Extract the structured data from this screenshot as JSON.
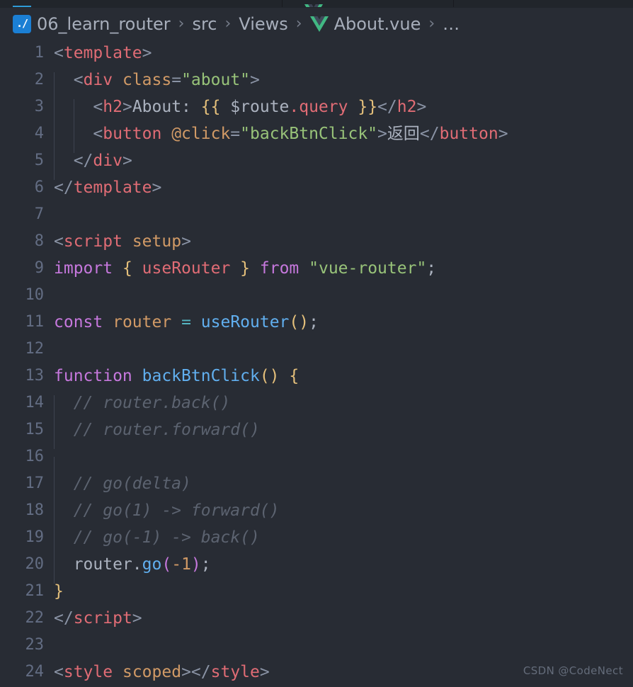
{
  "window": {
    "background": "#282c34",
    "tabbar_background": "#21252b",
    "accent": "#2f9bd8"
  },
  "breadcrumb": {
    "name": "breadcrumb",
    "separator": "›",
    "items": [
      {
        "label": "06_learn_router",
        "icon": "workspace-folder-icon"
      },
      {
        "label": "src",
        "icon": ""
      },
      {
        "label": "Views",
        "icon": ""
      },
      {
        "label": "About.vue",
        "icon": "vue-file-icon"
      },
      {
        "label": "…",
        "icon": ""
      }
    ]
  },
  "editor": {
    "language": "vue",
    "line_number_color": "#636d83",
    "lines": [
      {
        "n": "1",
        "tokens": [
          {
            "t": "<",
            "c": "t-punct"
          },
          {
            "t": "template",
            "c": "t-tag"
          },
          {
            "t": ">",
            "c": "t-punct"
          }
        ],
        "indent": 0
      },
      {
        "n": "2",
        "tokens": [
          {
            "t": "  ",
            "c": "t-text"
          },
          {
            "t": "<",
            "c": "t-punct"
          },
          {
            "t": "div",
            "c": "t-tag"
          },
          {
            "t": " ",
            "c": "t-text"
          },
          {
            "t": "class",
            "c": "t-attr"
          },
          {
            "t": "=",
            "c": "t-eq"
          },
          {
            "t": "\"about\"",
            "c": "t-str"
          },
          {
            "t": ">",
            "c": "t-punct"
          }
        ],
        "indent": 1
      },
      {
        "n": "3",
        "tokens": [
          {
            "t": "    ",
            "c": "t-text"
          },
          {
            "t": "<",
            "c": "t-punct"
          },
          {
            "t": "h2",
            "c": "t-tag"
          },
          {
            "t": ">",
            "c": "t-punct"
          },
          {
            "t": "About: ",
            "c": "t-text"
          },
          {
            "t": "{{",
            "c": "t-mustache"
          },
          {
            "t": " $route",
            "c": "t-text"
          },
          {
            "t": ".query",
            "c": "t-prop"
          },
          {
            "t": " ",
            "c": "t-text"
          },
          {
            "t": "}}",
            "c": "t-mustache"
          },
          {
            "t": "</",
            "c": "t-punct"
          },
          {
            "t": "h2",
            "c": "t-tag"
          },
          {
            "t": ">",
            "c": "t-punct"
          }
        ],
        "indent": 2
      },
      {
        "n": "4",
        "tokens": [
          {
            "t": "    ",
            "c": "t-text"
          },
          {
            "t": "<",
            "c": "t-punct"
          },
          {
            "t": "button",
            "c": "t-tag"
          },
          {
            "t": " ",
            "c": "t-text"
          },
          {
            "t": "@click",
            "c": "t-attr"
          },
          {
            "t": "=",
            "c": "t-eq"
          },
          {
            "t": "\"backBtnClick\"",
            "c": "t-str"
          },
          {
            "t": ">",
            "c": "t-punct"
          },
          {
            "t": "返回",
            "c": "t-text"
          },
          {
            "t": "</",
            "c": "t-punct"
          },
          {
            "t": "button",
            "c": "t-tag"
          },
          {
            "t": ">",
            "c": "t-punct"
          }
        ],
        "indent": 2
      },
      {
        "n": "5",
        "tokens": [
          {
            "t": "  ",
            "c": "t-text"
          },
          {
            "t": "</",
            "c": "t-punct"
          },
          {
            "t": "div",
            "c": "t-tag"
          },
          {
            "t": ">",
            "c": "t-punct"
          }
        ],
        "indent": 1
      },
      {
        "n": "6",
        "tokens": [
          {
            "t": "</",
            "c": "t-punct"
          },
          {
            "t": "template",
            "c": "t-tag"
          },
          {
            "t": ">",
            "c": "t-punct"
          }
        ],
        "indent": 0
      },
      {
        "n": "7",
        "tokens": [],
        "indent": 0
      },
      {
        "n": "8",
        "tokens": [
          {
            "t": "<",
            "c": "t-punct"
          },
          {
            "t": "script",
            "c": "t-tag"
          },
          {
            "t": " ",
            "c": "t-text"
          },
          {
            "t": "setup",
            "c": "t-attr"
          },
          {
            "t": ">",
            "c": "t-punct"
          }
        ],
        "indent": 0
      },
      {
        "n": "9",
        "tokens": [
          {
            "t": "import",
            "c": "t-kw"
          },
          {
            "t": " ",
            "c": "t-text"
          },
          {
            "t": "{",
            "c": "t-brace"
          },
          {
            "t": " ",
            "c": "t-text"
          },
          {
            "t": "useRouter",
            "c": "t-imp"
          },
          {
            "t": " ",
            "c": "t-text"
          },
          {
            "t": "}",
            "c": "t-brace"
          },
          {
            "t": " ",
            "c": "t-text"
          },
          {
            "t": "from",
            "c": "t-kw"
          },
          {
            "t": " ",
            "c": "t-text"
          },
          {
            "t": "\"vue-router\"",
            "c": "t-str"
          },
          {
            "t": ";",
            "c": "t-semi"
          }
        ],
        "indent": 0
      },
      {
        "n": "10",
        "tokens": [],
        "indent": 0
      },
      {
        "n": "11",
        "tokens": [
          {
            "t": "const",
            "c": "t-kw"
          },
          {
            "t": " ",
            "c": "t-text"
          },
          {
            "t": "router",
            "c": "t-var"
          },
          {
            "t": " ",
            "c": "t-text"
          },
          {
            "t": "=",
            "c": "t-op"
          },
          {
            "t": " ",
            "c": "t-text"
          },
          {
            "t": "useRouter",
            "c": "t-fn"
          },
          {
            "t": "()",
            "c": "t-paren"
          },
          {
            "t": ";",
            "c": "t-semi"
          }
        ],
        "indent": 0
      },
      {
        "n": "12",
        "tokens": [],
        "indent": 0
      },
      {
        "n": "13",
        "tokens": [
          {
            "t": "function",
            "c": "t-kw"
          },
          {
            "t": " ",
            "c": "t-text"
          },
          {
            "t": "backBtnClick",
            "c": "t-fn"
          },
          {
            "t": "()",
            "c": "t-paren"
          },
          {
            "t": " ",
            "c": "t-text"
          },
          {
            "t": "{",
            "c": "t-brace"
          }
        ],
        "indent": 0
      },
      {
        "n": "14",
        "tokens": [
          {
            "t": "  ",
            "c": "t-text"
          },
          {
            "t": "// router.back()",
            "c": "t-comment"
          }
        ],
        "indent": 1
      },
      {
        "n": "15",
        "tokens": [
          {
            "t": "  ",
            "c": "t-text"
          },
          {
            "t": "// router.forward()",
            "c": "t-comment"
          }
        ],
        "indent": 1
      },
      {
        "n": "16",
        "tokens": [],
        "indent": 1
      },
      {
        "n": "17",
        "tokens": [
          {
            "t": "  ",
            "c": "t-text"
          },
          {
            "t": "// go(delta)",
            "c": "t-comment"
          }
        ],
        "indent": 1
      },
      {
        "n": "18",
        "tokens": [
          {
            "t": "  ",
            "c": "t-text"
          },
          {
            "t": "// go(1) -> forward()",
            "c": "t-comment"
          }
        ],
        "indent": 1
      },
      {
        "n": "19",
        "tokens": [
          {
            "t": "  ",
            "c": "t-text"
          },
          {
            "t": "// go(-1) -> back()",
            "c": "t-comment"
          }
        ],
        "indent": 1
      },
      {
        "n": "20",
        "tokens": [
          {
            "t": "  ",
            "c": "t-text"
          },
          {
            "t": "router",
            "c": "t-text"
          },
          {
            "t": ".",
            "c": "t-text"
          },
          {
            "t": "go",
            "c": "t-fn"
          },
          {
            "t": "(",
            "c": "t-paren2"
          },
          {
            "t": "-1",
            "c": "t-num"
          },
          {
            "t": ")",
            "c": "t-paren2"
          },
          {
            "t": ";",
            "c": "t-semi"
          }
        ],
        "indent": 1
      },
      {
        "n": "21",
        "tokens": [
          {
            "t": "}",
            "c": "t-brace"
          }
        ],
        "indent": 0
      },
      {
        "n": "22",
        "tokens": [
          {
            "t": "</",
            "c": "t-punct"
          },
          {
            "t": "script",
            "c": "t-tag"
          },
          {
            "t": ">",
            "c": "t-punct"
          }
        ],
        "indent": 0
      },
      {
        "n": "23",
        "tokens": [],
        "indent": 0
      },
      {
        "n": "24",
        "tokens": [
          {
            "t": "<",
            "c": "t-punct"
          },
          {
            "t": "style",
            "c": "t-tag"
          },
          {
            "t": " ",
            "c": "t-text"
          },
          {
            "t": "scoped",
            "c": "t-attr"
          },
          {
            "t": ">",
            "c": "t-punct"
          },
          {
            "t": "</",
            "c": "t-punct"
          },
          {
            "t": "style",
            "c": "t-tag"
          },
          {
            "t": ">",
            "c": "t-punct"
          }
        ],
        "indent": 0
      }
    ]
  },
  "watermark": {
    "text": "CSDN @CodeNect"
  }
}
